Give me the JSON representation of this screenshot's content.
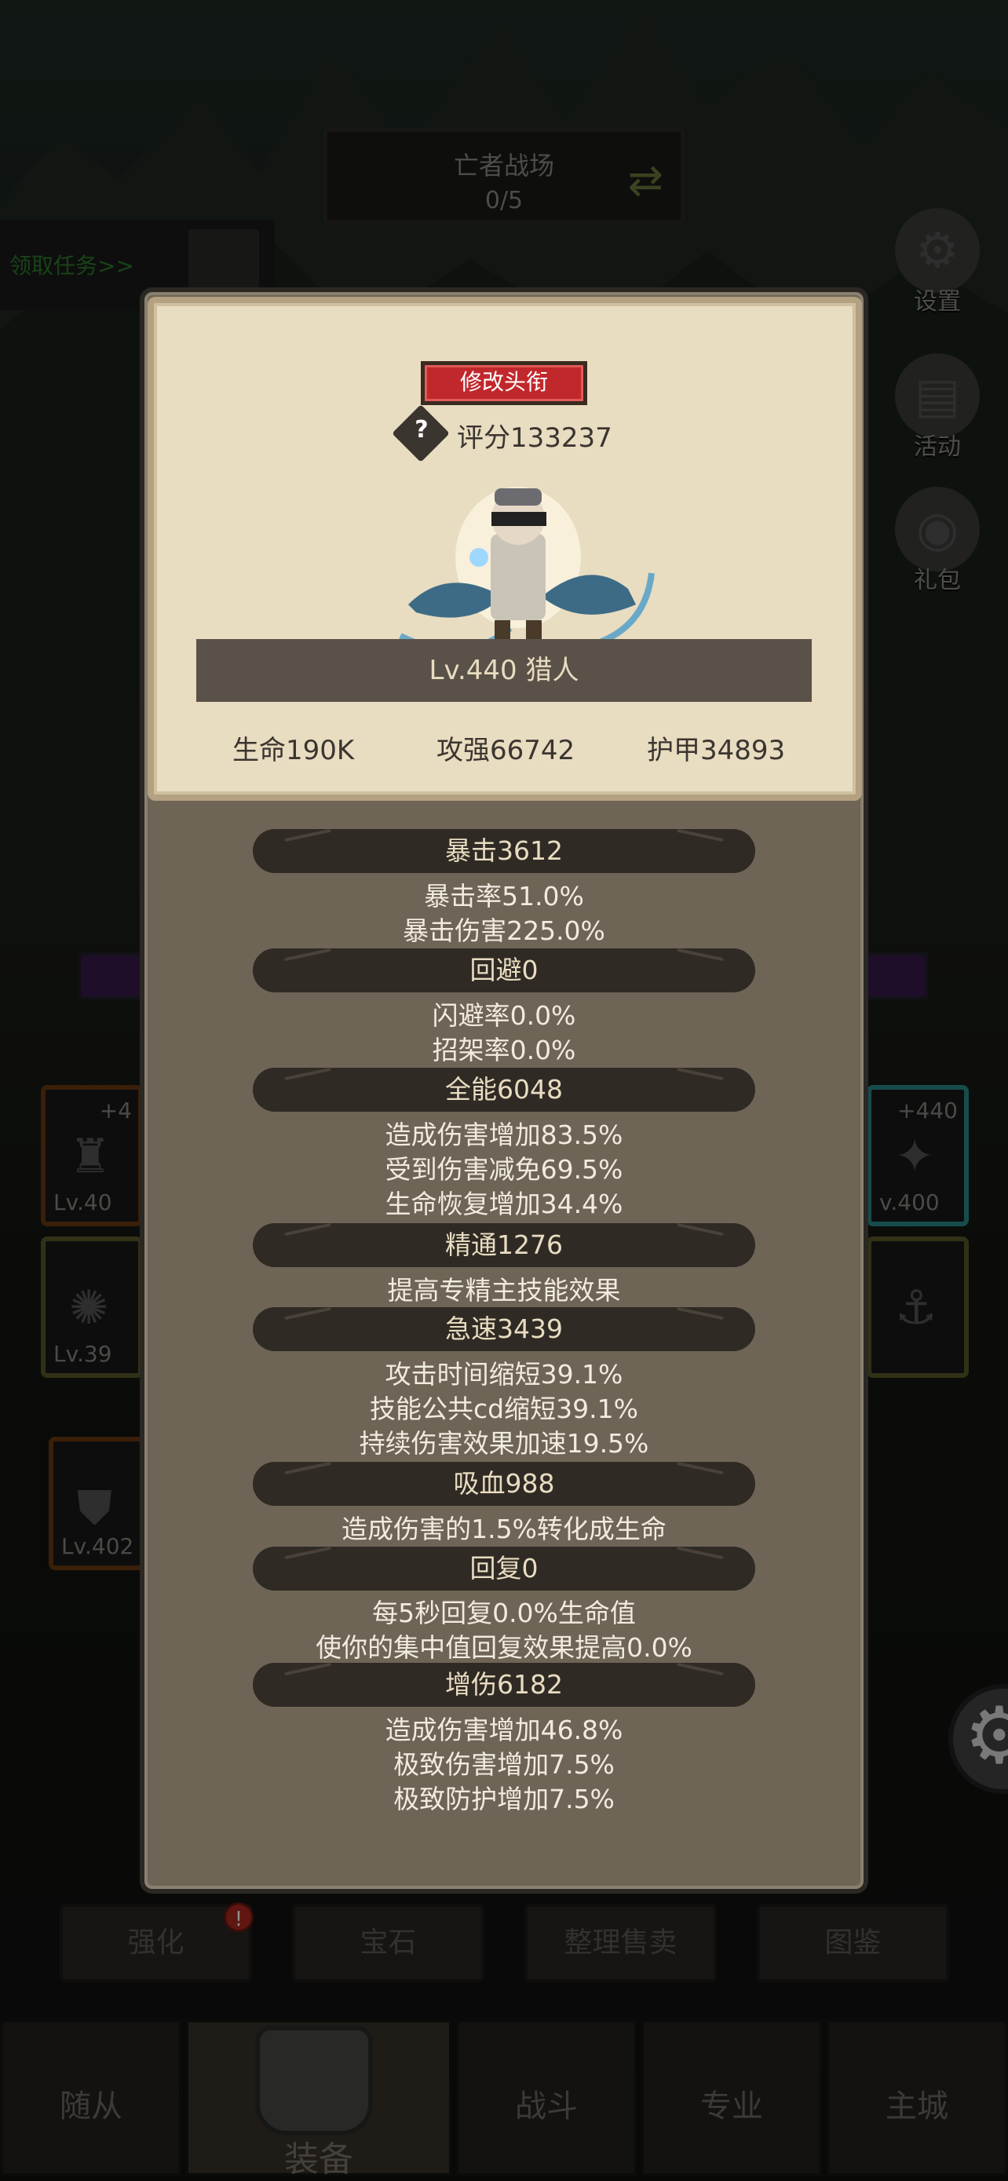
{
  "scene": {
    "arena_title": "亡者战场",
    "arena_progress": "0/5",
    "quest_link": "领取任务>>"
  },
  "side_buttons": [
    {
      "label": "设置",
      "icon": "gear-icon"
    },
    {
      "label": "活动",
      "icon": "scroll-icon"
    },
    {
      "label": "礼包",
      "icon": "gift-icon"
    }
  ],
  "equipment_tiles": [
    {
      "plus": "+4",
      "level": "Lv.40"
    },
    {
      "plus": "",
      "level": "Lv.39"
    },
    {
      "plus": "",
      "level": "Lv.402"
    },
    {
      "plus": "+440",
      "level": "v.400"
    }
  ],
  "action_buttons": [
    "强化",
    "宝石",
    "整理售卖",
    "图鉴"
  ],
  "alert_badge": "!",
  "nav_tabs": [
    "随从",
    "装备",
    "战斗",
    "专业",
    "主城"
  ],
  "character": {
    "change_title_button": "修改头衔",
    "help_icon_text": "?",
    "score": "评分133237",
    "level_class": "Lv.440 猎人",
    "hp": "生命190K",
    "attack": "攻强66742",
    "armor": "护甲34893"
  },
  "stat_groups": [
    {
      "header": "暴击3612",
      "lines": [
        "暴击率51.0%",
        "暴击伤害225.0%"
      ]
    },
    {
      "header": "回避0",
      "lines": [
        "闪避率0.0%",
        "招架率0.0%"
      ]
    },
    {
      "header": "全能6048",
      "lines": [
        "造成伤害增加83.5%",
        "受到伤害减免69.5%",
        "生命恢复增加34.4%"
      ]
    },
    {
      "header": "精通1276",
      "lines": [
        "提高专精主技能效果"
      ]
    },
    {
      "header": "急速3439",
      "lines": [
        "攻击时间缩短39.1%",
        "技能公共cd缩短39.1%",
        "持续伤害效果加速19.5%"
      ]
    },
    {
      "header": "吸血988",
      "lines": [
        "造成伤害的1.5%转化成生命"
      ]
    },
    {
      "header": "回复0",
      "lines": [
        "每5秒回复0.0%生命值",
        "使你的集中值回复效果提高0.0%"
      ]
    },
    {
      "header": "增伤6182",
      "lines": [
        "造成伤害增加46.8%",
        "极致伤害增加7.5%",
        "极致防护增加7.5%"
      ]
    }
  ]
}
